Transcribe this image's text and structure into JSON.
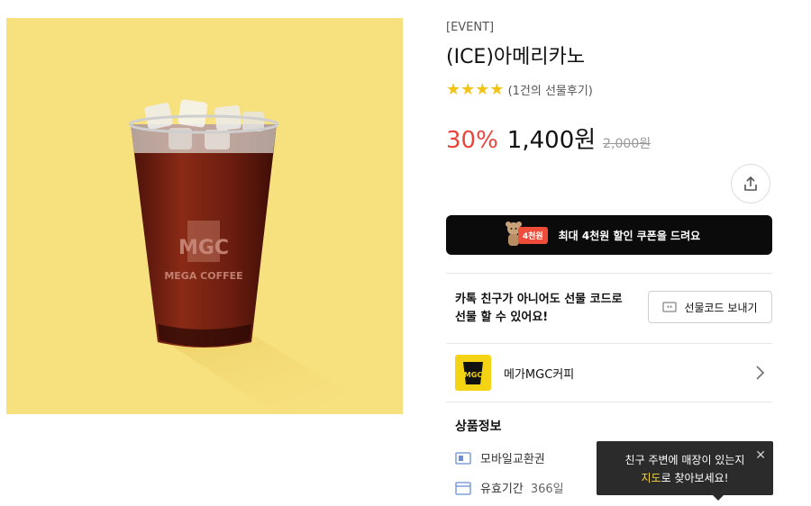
{
  "product": {
    "tag": "[EVENT]",
    "title": "(ICE)아메리카노",
    "rating_stars": 4,
    "review_count_text": "(1건의 선물후기)",
    "discount": "30%",
    "price": "1,400원",
    "original_price": "2,000원",
    "cup_logo": "MGC",
    "cup_brand": "MEGA COFFEE"
  },
  "coupon": {
    "badge": "4천원",
    "text": "최대 4천원 할인 쿠폰을 드려요"
  },
  "gift": {
    "line1": "카톡 친구가 아니어도 선물 코드로",
    "line2": "선물 할 수 있어요!",
    "button_label": "선물코드 보내기"
  },
  "brand": {
    "logo": "MGC",
    "name": "메가MGC커피"
  },
  "info": {
    "section_title": "상품정보",
    "type_label": "모바일교환권",
    "validity_label": "유효기간",
    "validity_value": "366일"
  },
  "tooltip": {
    "line1": "친구 주변에 매장이 있는지",
    "line2_highlight": "지도",
    "line2_rest": "로 찾아보세요!"
  },
  "colors": {
    "hero_bg": "#f7e07e",
    "discount": "#e8463d",
    "star": "#f2c317",
    "brand_yellow": "#f3d313",
    "coupon_bg": "#0b0b0b",
    "tooltip_highlight": "#f6d43a"
  },
  "icons": {
    "share": "share-icon",
    "gift": "gift-code-icon",
    "chevron": "chevron-right-icon",
    "ticket": "ticket-icon",
    "calendar": "calendar-icon",
    "close": "close-icon"
  }
}
